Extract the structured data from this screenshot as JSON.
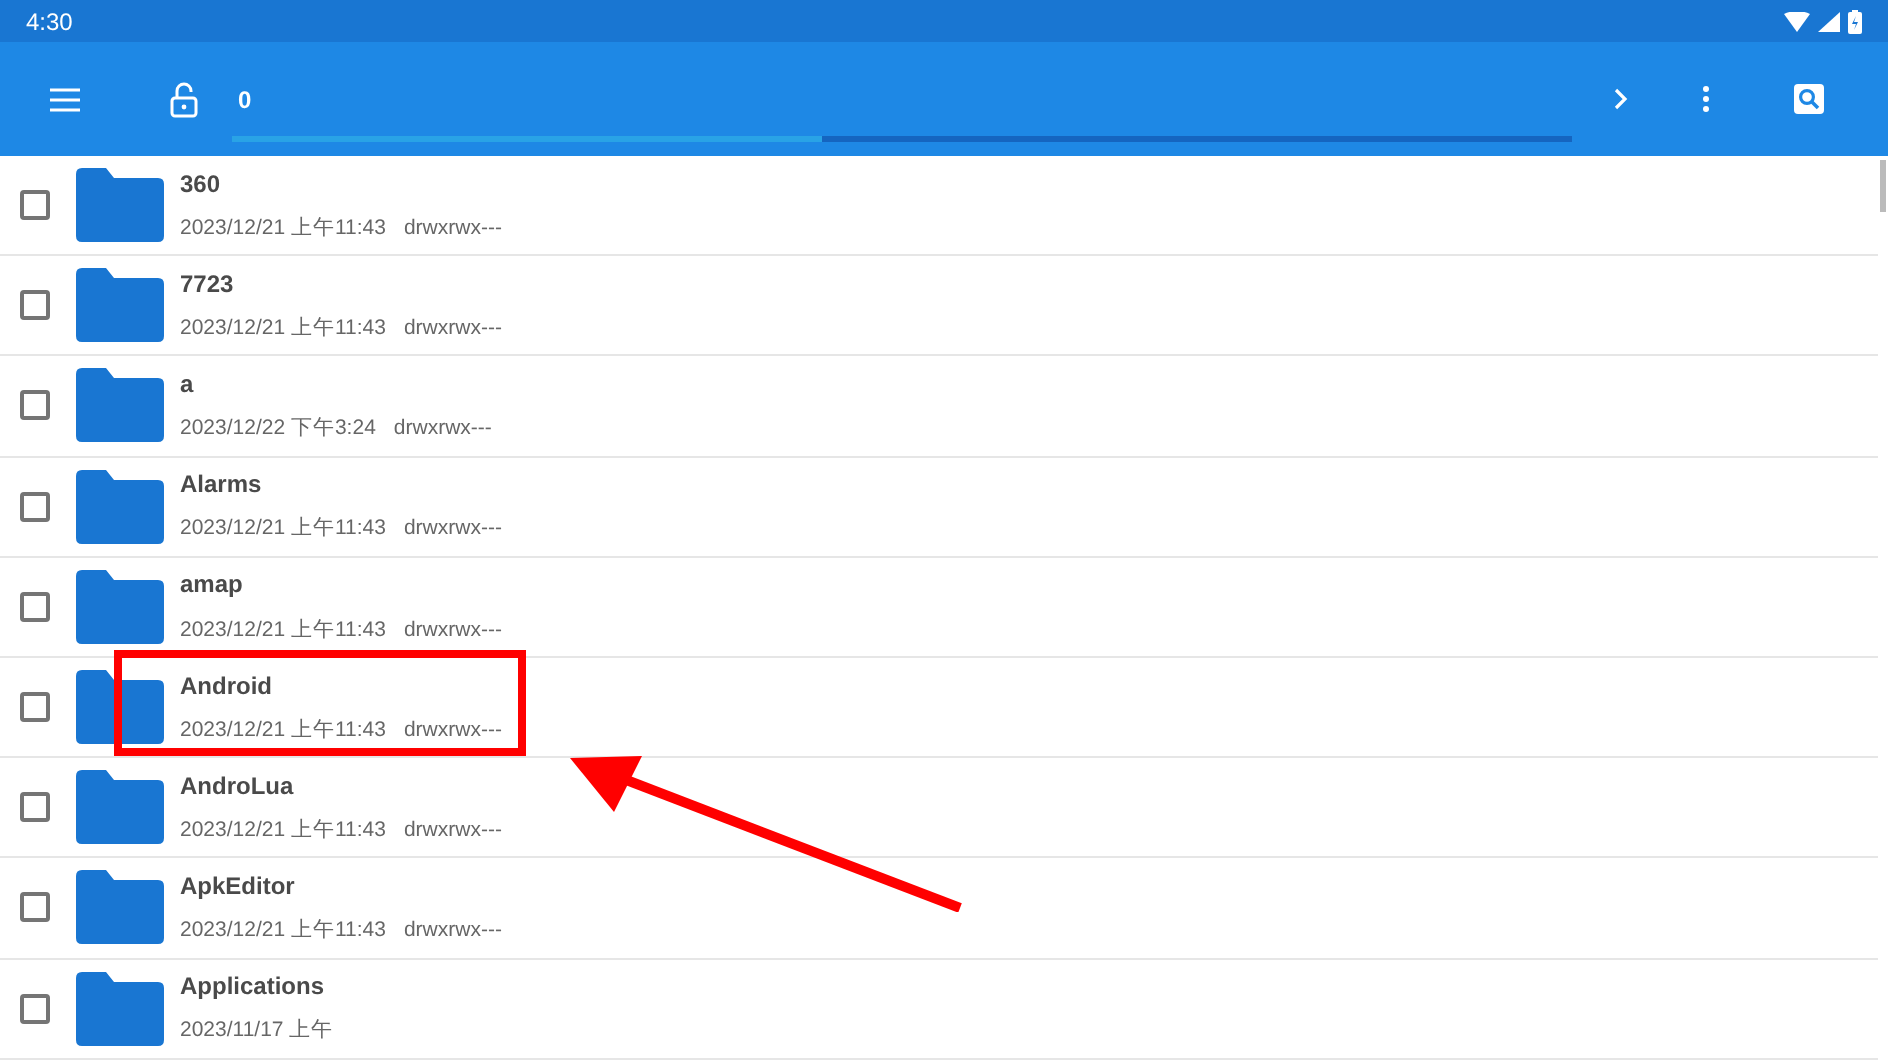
{
  "status_bar": {
    "time": "4:30"
  },
  "toolbar": {
    "path": "0",
    "progress": {
      "level": 0.44
    }
  },
  "files": [
    {
      "name": "360",
      "date": "2023/12/21 上午11:43",
      "permissions": "drwxrwx---",
      "checked": false
    },
    {
      "name": "7723",
      "date": "2023/12/21 上午11:43",
      "permissions": "drwxrwx---",
      "checked": false
    },
    {
      "name": "a",
      "date": "2023/12/22 下午3:24",
      "permissions": "drwxrwx---",
      "checked": false
    },
    {
      "name": "Alarms",
      "date": "2023/12/21 上午11:43",
      "permissions": "drwxrwx---",
      "checked": false
    },
    {
      "name": "amap",
      "date": "2023/12/21 上午11:43",
      "permissions": "drwxrwx---",
      "checked": false
    },
    {
      "name": "Android",
      "date": "2023/12/21 上午11:43",
      "permissions": "drwxrwx---",
      "checked": false
    },
    {
      "name": "AndroLua",
      "date": "2023/12/21 上午11:43",
      "permissions": "drwxrwx---",
      "checked": false
    },
    {
      "name": "ApkEditor",
      "date": "2023/12/21 上午11:43",
      "permissions": "drwxrwx---",
      "checked": false
    },
    {
      "name": "Applications",
      "date": "2023/11/17 上午",
      "checked": false
    }
  ],
  "annotations": {
    "highlight_frame": true,
    "arrow": true
  }
}
